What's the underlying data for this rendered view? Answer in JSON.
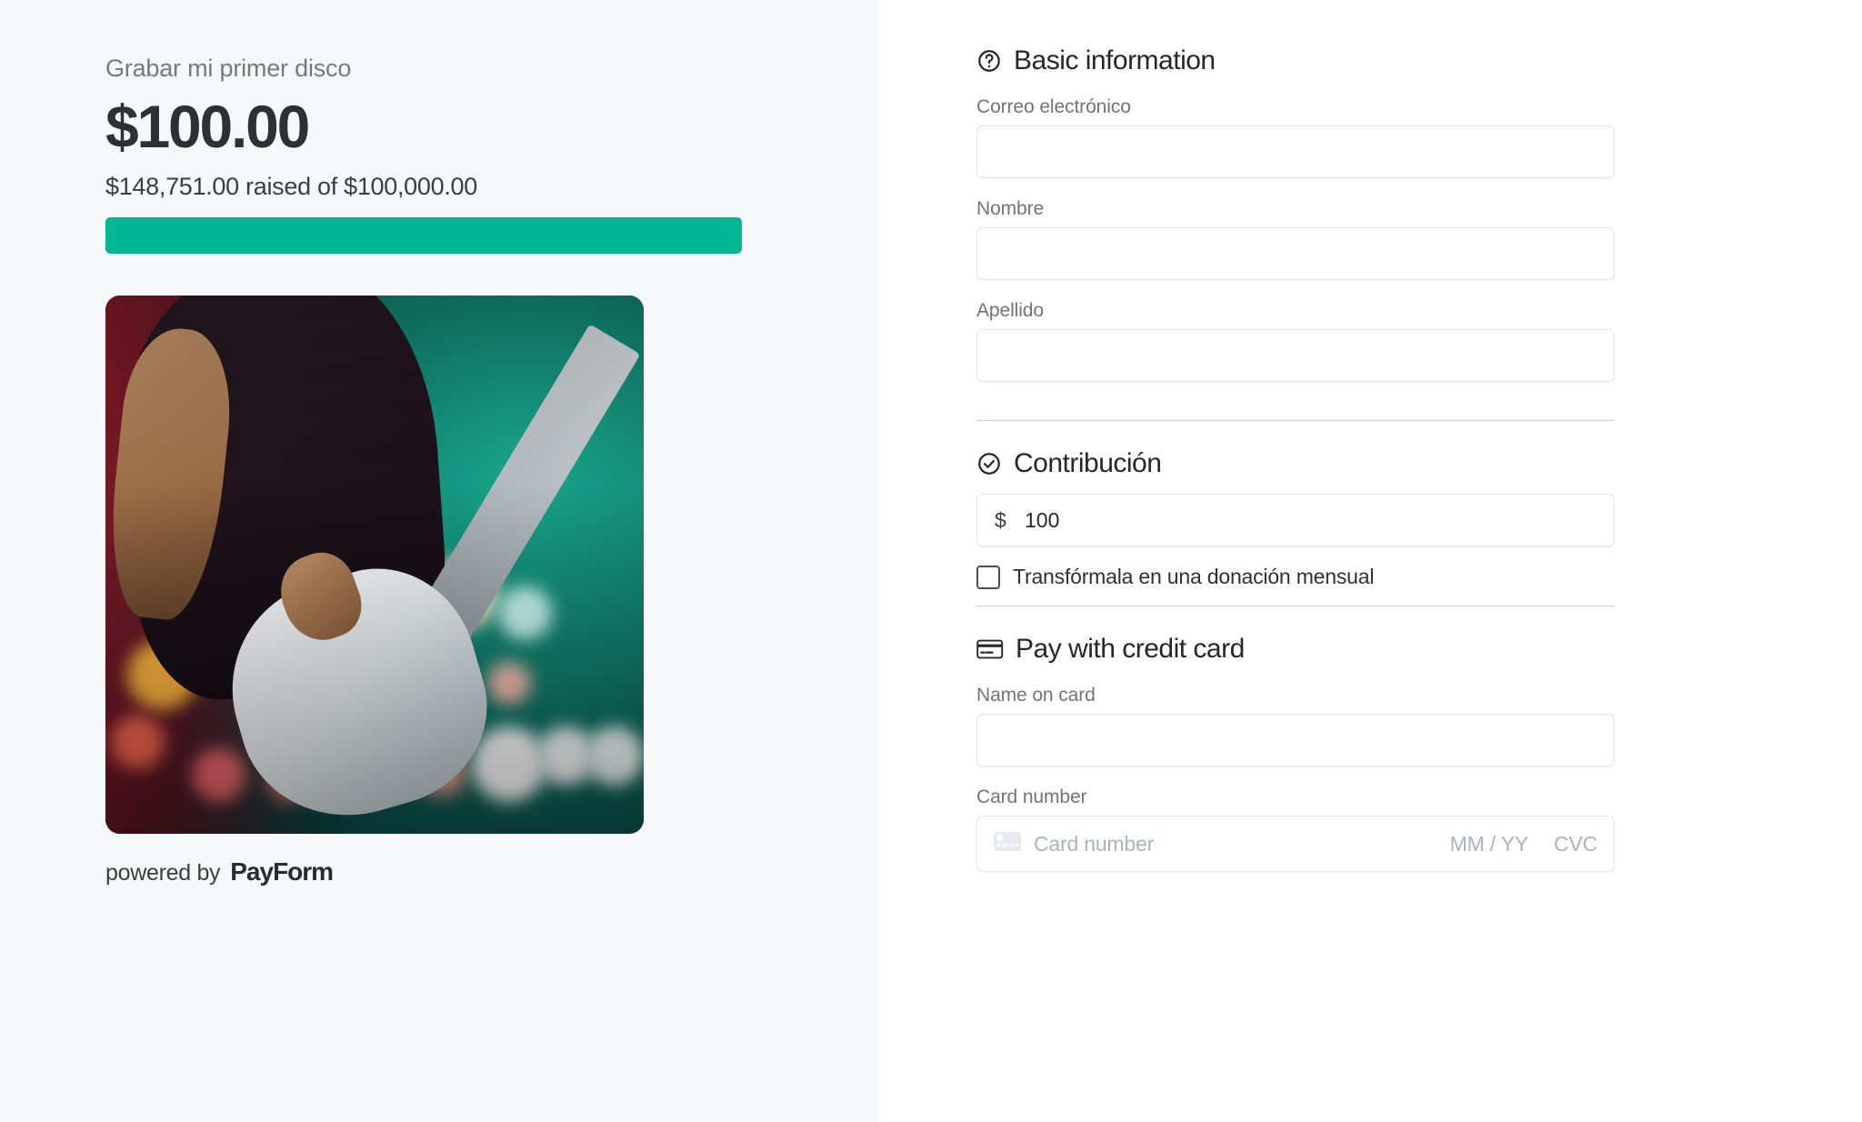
{
  "left": {
    "campaign_title": "Grabar mi primer disco",
    "amount_display": "$100.00",
    "raised_text": "$148,751.00 raised of $100,000.00",
    "progress": {
      "raised": 148751.0,
      "goal": 100000.0,
      "percent": 100,
      "fill_color": "#00b894",
      "track_color": "#e7e9ec"
    },
    "photo_alt": "Bassist playing a white bass guitar on a teal-lit stage",
    "footer": {
      "powered_by": "powered by",
      "brand": "PayForm"
    }
  },
  "form": {
    "basic": {
      "heading": "Basic information",
      "heading_icon": "question-circle-icon",
      "fields": [
        {
          "label": "Correo electrónico",
          "value": "",
          "placeholder": ""
        },
        {
          "label": "Nombre",
          "value": "",
          "placeholder": ""
        },
        {
          "label": "Apellido",
          "value": "",
          "placeholder": ""
        }
      ]
    },
    "contribution": {
      "heading": "Contribución",
      "heading_icon": "check-circle-icon",
      "currency_symbol": "$",
      "amount_value": "100",
      "amount_placeholder": "",
      "recurring_label": "Transfórmala en una donación mensual",
      "recurring_checked": false
    },
    "card": {
      "heading": "Pay with credit card",
      "heading_icon": "credit-card-icon",
      "name_label": "Name on card",
      "name_value": "",
      "name_placeholder": "",
      "number_label": "Card number",
      "number_placeholder": "Card number",
      "expiry_placeholder": "MM / YY",
      "cvc_placeholder": "CVC"
    }
  },
  "colors": {
    "accent": "#00b894",
    "panel_bg": "#f7f8fa",
    "text_primary": "#26272a",
    "text_muted": "#72747a",
    "border": "#e4e6ea"
  }
}
